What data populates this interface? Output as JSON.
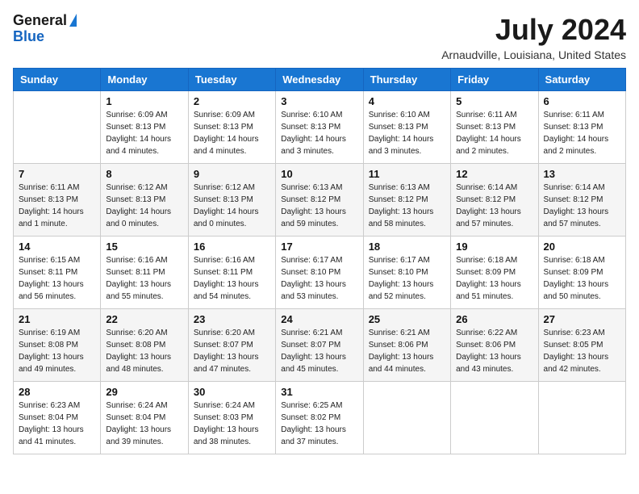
{
  "logo": {
    "general": "General",
    "blue": "Blue"
  },
  "title": "July 2024",
  "subtitle": "Arnaudville, Louisiana, United States",
  "weekdays": [
    "Sunday",
    "Monday",
    "Tuesday",
    "Wednesday",
    "Thursday",
    "Friday",
    "Saturday"
  ],
  "weeks": [
    [
      {
        "day": "",
        "info": ""
      },
      {
        "day": "1",
        "info": "Sunrise: 6:09 AM\nSunset: 8:13 PM\nDaylight: 14 hours\nand 4 minutes."
      },
      {
        "day": "2",
        "info": "Sunrise: 6:09 AM\nSunset: 8:13 PM\nDaylight: 14 hours\nand 4 minutes."
      },
      {
        "day": "3",
        "info": "Sunrise: 6:10 AM\nSunset: 8:13 PM\nDaylight: 14 hours\nand 3 minutes."
      },
      {
        "day": "4",
        "info": "Sunrise: 6:10 AM\nSunset: 8:13 PM\nDaylight: 14 hours\nand 3 minutes."
      },
      {
        "day": "5",
        "info": "Sunrise: 6:11 AM\nSunset: 8:13 PM\nDaylight: 14 hours\nand 2 minutes."
      },
      {
        "day": "6",
        "info": "Sunrise: 6:11 AM\nSunset: 8:13 PM\nDaylight: 14 hours\nand 2 minutes."
      }
    ],
    [
      {
        "day": "7",
        "info": "Sunrise: 6:11 AM\nSunset: 8:13 PM\nDaylight: 14 hours\nand 1 minute."
      },
      {
        "day": "8",
        "info": "Sunrise: 6:12 AM\nSunset: 8:13 PM\nDaylight: 14 hours\nand 0 minutes."
      },
      {
        "day": "9",
        "info": "Sunrise: 6:12 AM\nSunset: 8:13 PM\nDaylight: 14 hours\nand 0 minutes."
      },
      {
        "day": "10",
        "info": "Sunrise: 6:13 AM\nSunset: 8:12 PM\nDaylight: 13 hours\nand 59 minutes."
      },
      {
        "day": "11",
        "info": "Sunrise: 6:13 AM\nSunset: 8:12 PM\nDaylight: 13 hours\nand 58 minutes."
      },
      {
        "day": "12",
        "info": "Sunrise: 6:14 AM\nSunset: 8:12 PM\nDaylight: 13 hours\nand 57 minutes."
      },
      {
        "day": "13",
        "info": "Sunrise: 6:14 AM\nSunset: 8:12 PM\nDaylight: 13 hours\nand 57 minutes."
      }
    ],
    [
      {
        "day": "14",
        "info": "Sunrise: 6:15 AM\nSunset: 8:11 PM\nDaylight: 13 hours\nand 56 minutes."
      },
      {
        "day": "15",
        "info": "Sunrise: 6:16 AM\nSunset: 8:11 PM\nDaylight: 13 hours\nand 55 minutes."
      },
      {
        "day": "16",
        "info": "Sunrise: 6:16 AM\nSunset: 8:11 PM\nDaylight: 13 hours\nand 54 minutes."
      },
      {
        "day": "17",
        "info": "Sunrise: 6:17 AM\nSunset: 8:10 PM\nDaylight: 13 hours\nand 53 minutes."
      },
      {
        "day": "18",
        "info": "Sunrise: 6:17 AM\nSunset: 8:10 PM\nDaylight: 13 hours\nand 52 minutes."
      },
      {
        "day": "19",
        "info": "Sunrise: 6:18 AM\nSunset: 8:09 PM\nDaylight: 13 hours\nand 51 minutes."
      },
      {
        "day": "20",
        "info": "Sunrise: 6:18 AM\nSunset: 8:09 PM\nDaylight: 13 hours\nand 50 minutes."
      }
    ],
    [
      {
        "day": "21",
        "info": "Sunrise: 6:19 AM\nSunset: 8:08 PM\nDaylight: 13 hours\nand 49 minutes."
      },
      {
        "day": "22",
        "info": "Sunrise: 6:20 AM\nSunset: 8:08 PM\nDaylight: 13 hours\nand 48 minutes."
      },
      {
        "day": "23",
        "info": "Sunrise: 6:20 AM\nSunset: 8:07 PM\nDaylight: 13 hours\nand 47 minutes."
      },
      {
        "day": "24",
        "info": "Sunrise: 6:21 AM\nSunset: 8:07 PM\nDaylight: 13 hours\nand 45 minutes."
      },
      {
        "day": "25",
        "info": "Sunrise: 6:21 AM\nSunset: 8:06 PM\nDaylight: 13 hours\nand 44 minutes."
      },
      {
        "day": "26",
        "info": "Sunrise: 6:22 AM\nSunset: 8:06 PM\nDaylight: 13 hours\nand 43 minutes."
      },
      {
        "day": "27",
        "info": "Sunrise: 6:23 AM\nSunset: 8:05 PM\nDaylight: 13 hours\nand 42 minutes."
      }
    ],
    [
      {
        "day": "28",
        "info": "Sunrise: 6:23 AM\nSunset: 8:04 PM\nDaylight: 13 hours\nand 41 minutes."
      },
      {
        "day": "29",
        "info": "Sunrise: 6:24 AM\nSunset: 8:04 PM\nDaylight: 13 hours\nand 39 minutes."
      },
      {
        "day": "30",
        "info": "Sunrise: 6:24 AM\nSunset: 8:03 PM\nDaylight: 13 hours\nand 38 minutes."
      },
      {
        "day": "31",
        "info": "Sunrise: 6:25 AM\nSunset: 8:02 PM\nDaylight: 13 hours\nand 37 minutes."
      },
      {
        "day": "",
        "info": ""
      },
      {
        "day": "",
        "info": ""
      },
      {
        "day": "",
        "info": ""
      }
    ]
  ]
}
